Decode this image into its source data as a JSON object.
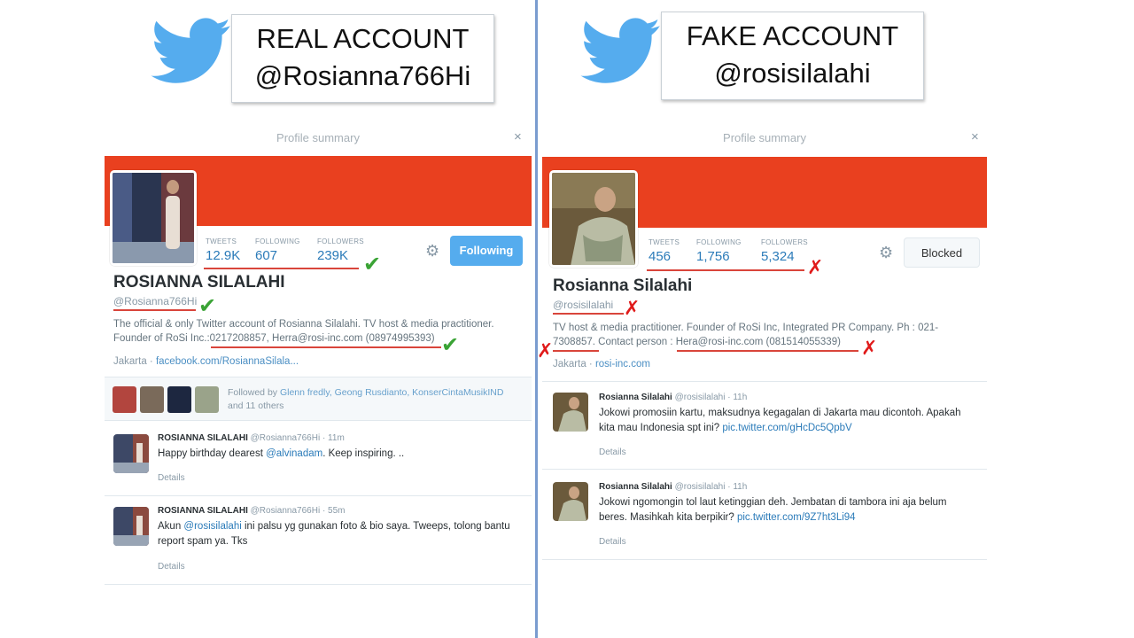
{
  "left": {
    "title_line1": "REAL ACCOUNT",
    "title_line2": "@Rosianna766Hi",
    "panel_title": "Profile summary",
    "close": "×",
    "stats": [
      {
        "label": "TWEETS",
        "value": "12.9K"
      },
      {
        "label": "FOLLOWING",
        "value": "607"
      },
      {
        "label": "FOLLOWERS",
        "value": "239K"
      }
    ],
    "button": "Following",
    "name": "ROSIANNA SILALAHI",
    "handle": "@Rosianna766Hi",
    "bio_line1": "The official & only Twitter account of Rosianna Silalahi. TV host & media practitioner.",
    "bio_line2": "Founder of RoSi Inc.:0217208857, Herra@rosi-inc.com (08974995393)",
    "location": "Jakarta",
    "location_sep": " · ",
    "link": "facebook.com/RosiannaSilala...",
    "followed_prefix": "Followed by ",
    "followed_names": "Glenn fredly, Geong Rusdianto, KonserCintaMusikIND",
    "followed_suffix": "and 11 others",
    "tweets": [
      {
        "name": "ROSIANNA SILALAHI",
        "handle": "@Rosianna766Hi",
        "time": "· 11m",
        "text_pre": "Happy birthday dearest ",
        "text_link": "@alvinadam",
        "text_post": ". Keep inspiring. ..",
        "details": "Details"
      },
      {
        "name": "ROSIANNA SILALAHI",
        "handle": "@Rosianna766Hi",
        "time": "· 55m",
        "text_pre": "Akun ",
        "text_link": "@rosisilalahi",
        "text_post": " ini palsu yg gunakan foto & bio saya. Tweeps, tolong bantu report spam ya. Tks",
        "details": "Details"
      }
    ],
    "marks": {
      "check": "✔"
    }
  },
  "right": {
    "title_line1": "FAKE ACCOUNT",
    "title_line2": "@rosisilalahi",
    "panel_title": "Profile summary",
    "close": "×",
    "stats": [
      {
        "label": "TWEETS",
        "value": "456"
      },
      {
        "label": "FOLLOWING",
        "value": "1,756"
      },
      {
        "label": "FOLLOWERS",
        "value": "5,324"
      }
    ],
    "button": "Blocked",
    "name": "Rosianna Silalahi",
    "handle": "@rosisilalahi",
    "bio_line1": "TV host & media practitioner. Founder of RoSi Inc, Integrated PR Company. Ph : 021-",
    "bio_line2": "7308857. Contact person : Hera@rosi-inc.com (081514055339)",
    "location": "Jakarta",
    "location_sep": " · ",
    "link": "rosi-inc.com",
    "tweets": [
      {
        "name": "Rosianna Silalahi",
        "handle": "@rosisilalahi",
        "time": "· 11h",
        "text_pre": "Jokowi promosiin kartu, maksudnya kegagalan di Jakarta mau dicontoh. Apakah kita mau Indonesia spt ini? ",
        "text_link": "pic.twitter.com/gHcDc5QpbV",
        "text_post": "",
        "details": "Details"
      },
      {
        "name": "Rosianna Silalahi",
        "handle": "@rosisilalahi",
        "time": "· 11h",
        "text_pre": "Jokowi ngomongin tol laut ketinggian deh. Jembatan di tambora ini aja belum beres. Masihkah kita berpikir? ",
        "text_link": "pic.twitter.com/9Z7ht3Li94",
        "text_post": "",
        "details": "Details"
      }
    ],
    "marks": {
      "cross": "✗"
    }
  },
  "colors": {
    "banner": "#e9401f",
    "link": "#2b7bb9",
    "check": "#3aa335",
    "cross": "#e01a1a",
    "divider": "#7a9ccf",
    "twitter_blue": "#55acee"
  },
  "icons": [
    "twitter-bird-icon",
    "gear-icon",
    "close-icon",
    "check-mark-icon",
    "cross-mark-icon"
  ]
}
